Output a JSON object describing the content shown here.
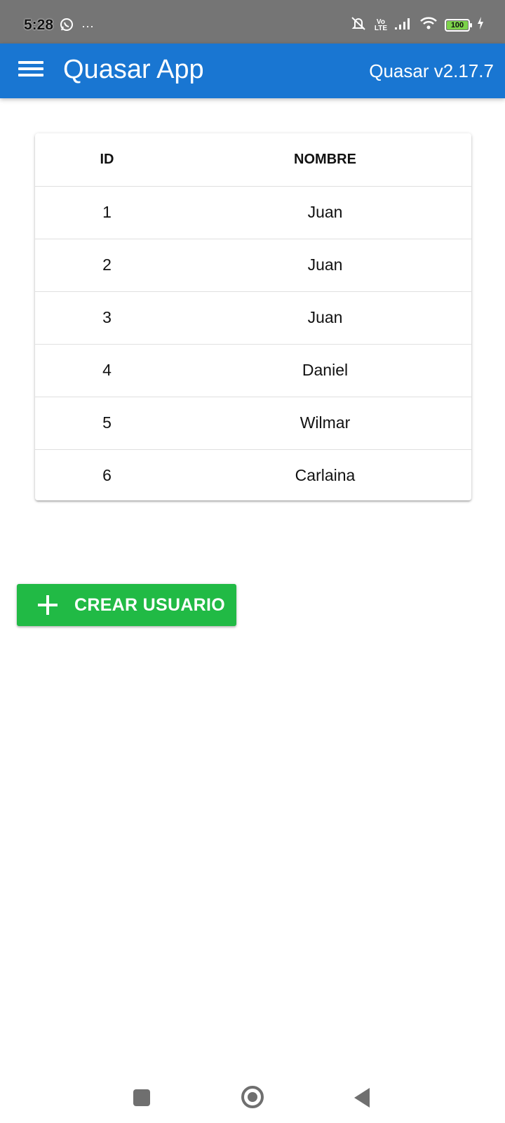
{
  "status_bar": {
    "time": "5:28",
    "battery": "100",
    "icons": [
      "whatsapp-icon",
      "more-dots-icon",
      "mute-icon",
      "volte-icon",
      "signal-icon",
      "wifi-icon",
      "battery-icon",
      "charging-icon"
    ],
    "volte_top": "Vo",
    "volte_bottom": "LTE",
    "more": "···"
  },
  "app_bar": {
    "title": "Quasar App",
    "version": "Quasar v2.17.7",
    "color": "#1976d2"
  },
  "table": {
    "columns": [
      "ID",
      "NOMBRE"
    ],
    "rows": [
      {
        "id": "1",
        "nombre": "Juan"
      },
      {
        "id": "2",
        "nombre": "Juan"
      },
      {
        "id": "3",
        "nombre": "Juan"
      },
      {
        "id": "4",
        "nombre": "Daniel"
      },
      {
        "id": "5",
        "nombre": "Wilmar"
      },
      {
        "id": "6",
        "nombre": "Carlaina"
      }
    ]
  },
  "create_button": {
    "label": "CREAR USUARIO",
    "icon": "plus-icon",
    "color": "#21ba45"
  },
  "nav_bar": {
    "icons": [
      "recents-icon",
      "home-icon",
      "back-icon"
    ]
  }
}
